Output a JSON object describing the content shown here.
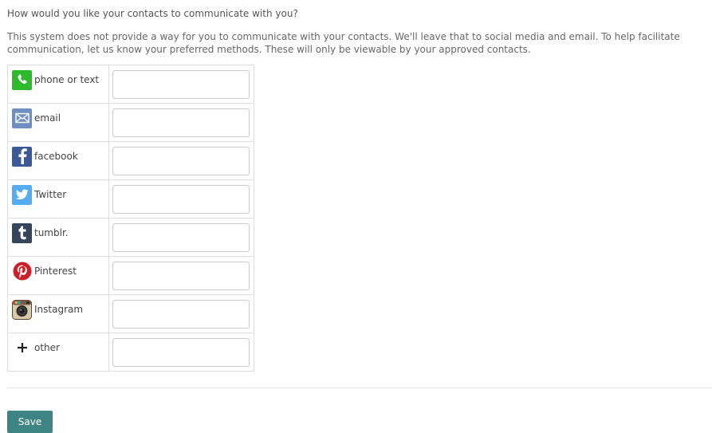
{
  "question": "How would you like your contacts to communicate with you?",
  "description": "This system does not provide a way for you to communicate with your contacts. We'll leave that to social media and email. To help facilitate communication, let us know your preferred methods. These will only be viewable by your approved contacts.",
  "methods": [
    {
      "label": "phone or text",
      "icon": "phone-icon",
      "value": "",
      "placeholder": ""
    },
    {
      "label": "email",
      "icon": "envelope-icon",
      "value": "",
      "placeholder": ""
    },
    {
      "label": "facebook",
      "icon": "facebook-icon",
      "value": "",
      "placeholder": ""
    },
    {
      "label": "Twitter",
      "icon": "twitter-icon",
      "value": "",
      "placeholder": ""
    },
    {
      "label": "tumblr.",
      "icon": "tumblr-icon",
      "value": "",
      "placeholder": ""
    },
    {
      "label": "Pinterest",
      "icon": "pinterest-icon",
      "value": "",
      "placeholder": ""
    },
    {
      "label": "Instagram",
      "icon": "instagram-icon",
      "value": "",
      "placeholder": ""
    },
    {
      "label": "other",
      "icon": "plus-icon",
      "value": "",
      "placeholder": ""
    }
  ],
  "save_label": "Save",
  "colors": {
    "save_button": "#3e8484",
    "phone": "#2dbb2d",
    "email": "#6f8fc0",
    "facebook": "#3b5998",
    "twitter": "#55acee",
    "tumblr": "#35465c",
    "pinterest": "#cb2027"
  }
}
